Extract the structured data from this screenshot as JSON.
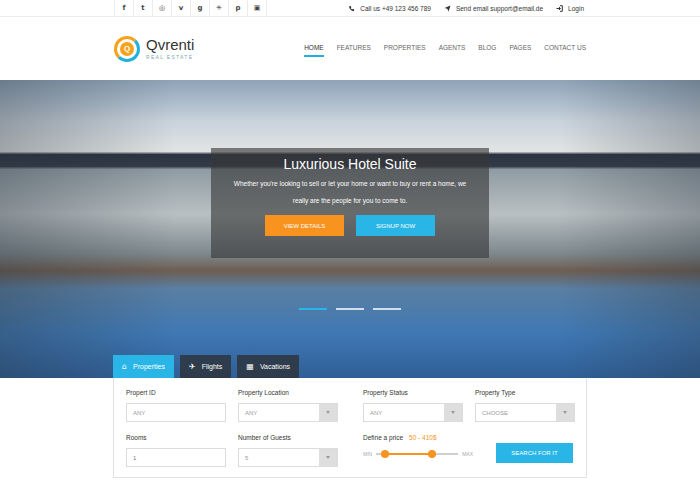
{
  "topbar": {
    "social": [
      "f",
      "t",
      "◎",
      "v",
      "g",
      "✳",
      "p",
      "▣"
    ],
    "phone": "Call us +49 123 456 789",
    "email": "Send email support@email.de",
    "login": "Login"
  },
  "logo": {
    "mark": "Q",
    "name": "Qvrenti",
    "tagline": "REAL ESTATE"
  },
  "nav": [
    {
      "label": "HOME",
      "selected": true
    },
    {
      "label": "FEATURES",
      "selected": false
    },
    {
      "label": "PROPERTIES",
      "selected": false
    },
    {
      "label": "AGENTS",
      "selected": false
    },
    {
      "label": "BLOG",
      "selected": false
    },
    {
      "label": "PAGES",
      "selected": false
    },
    {
      "label": "CONTACT US",
      "selected": false
    }
  ],
  "hero": {
    "title": "Luxurious Hotel Suite",
    "text": "Whether you're looking to sell or let your home or want to buy or rent a home, we really are the people for you to come to.",
    "buttons": [
      {
        "label": "VIEW DETAILS",
        "kind": "accent"
      },
      {
        "label": "SIGNUP NOW",
        "kind": "primary"
      }
    ],
    "slides": [
      {
        "selected": true
      },
      {
        "selected": false
      },
      {
        "selected": false
      }
    ]
  },
  "search_tabs": [
    {
      "icon": "⌂",
      "label": "Properties",
      "selected": true
    },
    {
      "icon": "✈",
      "label": "Flights",
      "selected": false
    },
    {
      "icon": "▦",
      "label": "Vacations",
      "selected": false
    }
  ],
  "form": {
    "fields": [
      {
        "label": "Propert ID",
        "kind": "input",
        "placeholder": "ANY"
      },
      {
        "label": "Property Location",
        "kind": "select",
        "value": "ANY"
      },
      {
        "label": "Property Status",
        "kind": "select",
        "value": "ANY"
      },
      {
        "label": "Property Type",
        "kind": "select",
        "value": "CHOOSE"
      },
      {
        "label": "Rooms",
        "kind": "input",
        "value": "1"
      },
      {
        "label": "Number of Guests",
        "kind": "select",
        "value": "5"
      }
    ],
    "price": {
      "label": "Define a price",
      "reading": "50 - 410$",
      "min": "MIN",
      "max": "MAX",
      "low_level": 0.11,
      "high_level": 0.68
    },
    "submit": "SEARCH FOR IT"
  }
}
